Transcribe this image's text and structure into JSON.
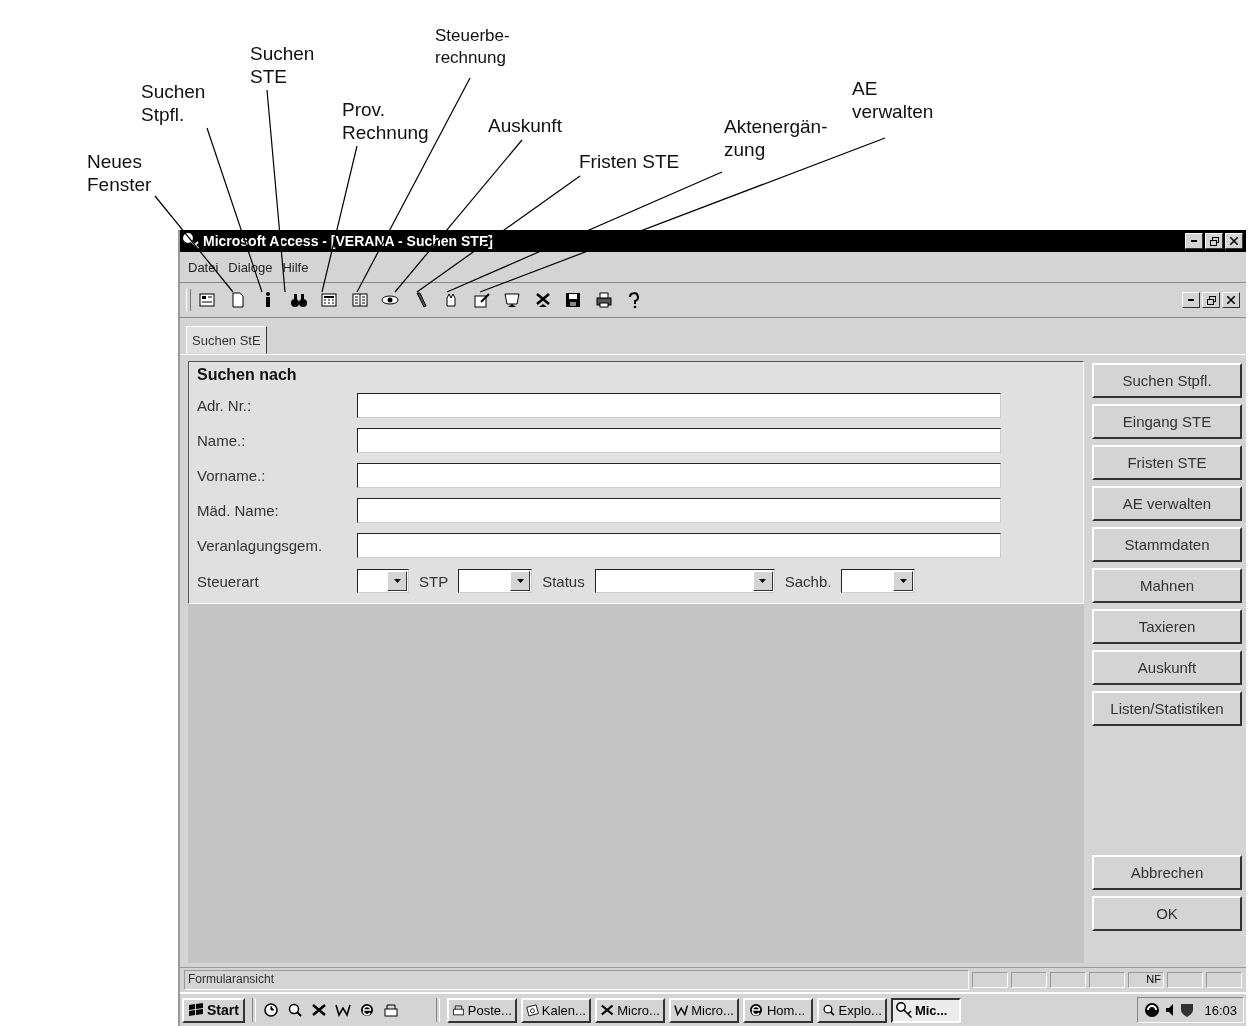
{
  "annotations": [
    {
      "text": "Neues\nFenster"
    },
    {
      "text": "Suchen\nStpfl."
    },
    {
      "text": "Suchen\nSTE"
    },
    {
      "text": "Prov.\nRechnung"
    },
    {
      "text": "Steuerbe-\nrechnung"
    },
    {
      "text": "Auskunft"
    },
    {
      "text": "Fristen STE"
    },
    {
      "text": "Aktenergän-\nzung"
    },
    {
      "text": "AE\nverwalten"
    }
  ],
  "window": {
    "title": "Microsoft Access - [VERANA - Suchen STE]"
  },
  "menu": [
    "Datei",
    "Dialoge",
    "Hilfe"
  ],
  "tabs": [
    {
      "label": "Suchen StE",
      "selected": true
    }
  ],
  "form": {
    "title": "Suchen nach",
    "fields": [
      {
        "label": "Adr. Nr.:"
      },
      {
        "label": "Name.:"
      },
      {
        "label": "Vorname.:"
      },
      {
        "label": "Mäd. Name:"
      },
      {
        "label": "Veranlagungsgem."
      }
    ],
    "combos": [
      {
        "label": "Steuerart"
      },
      {
        "label": "STP"
      },
      {
        "label": "Status"
      },
      {
        "label": "Sachb."
      }
    ]
  },
  "side_buttons": [
    "Suchen Stpfl.",
    "Eingang STE",
    "Fristen STE",
    "AE verwalten",
    "Stammdaten",
    "Mahnen",
    "Taxieren",
    "Auskunft",
    "Listen/Statistiken"
  ],
  "dialog_buttons": [
    "Abbrechen",
    "OK"
  ],
  "status_bar": {
    "text": "Formularansicht",
    "mode_indicator": "NF"
  },
  "taskbar": {
    "start": "Start",
    "tasks": [
      {
        "label": "Poste...",
        "selected": false
      },
      {
        "label": "Kalen...",
        "selected": false
      },
      {
        "label": "Micro...",
        "selected": false
      },
      {
        "label": "Micro...",
        "selected": false
      },
      {
        "label": "Hom...",
        "selected": false
      },
      {
        "label": "Explo...",
        "selected": false
      },
      {
        "label": "Mic...",
        "selected": true
      }
    ],
    "clock": "16:03"
  }
}
